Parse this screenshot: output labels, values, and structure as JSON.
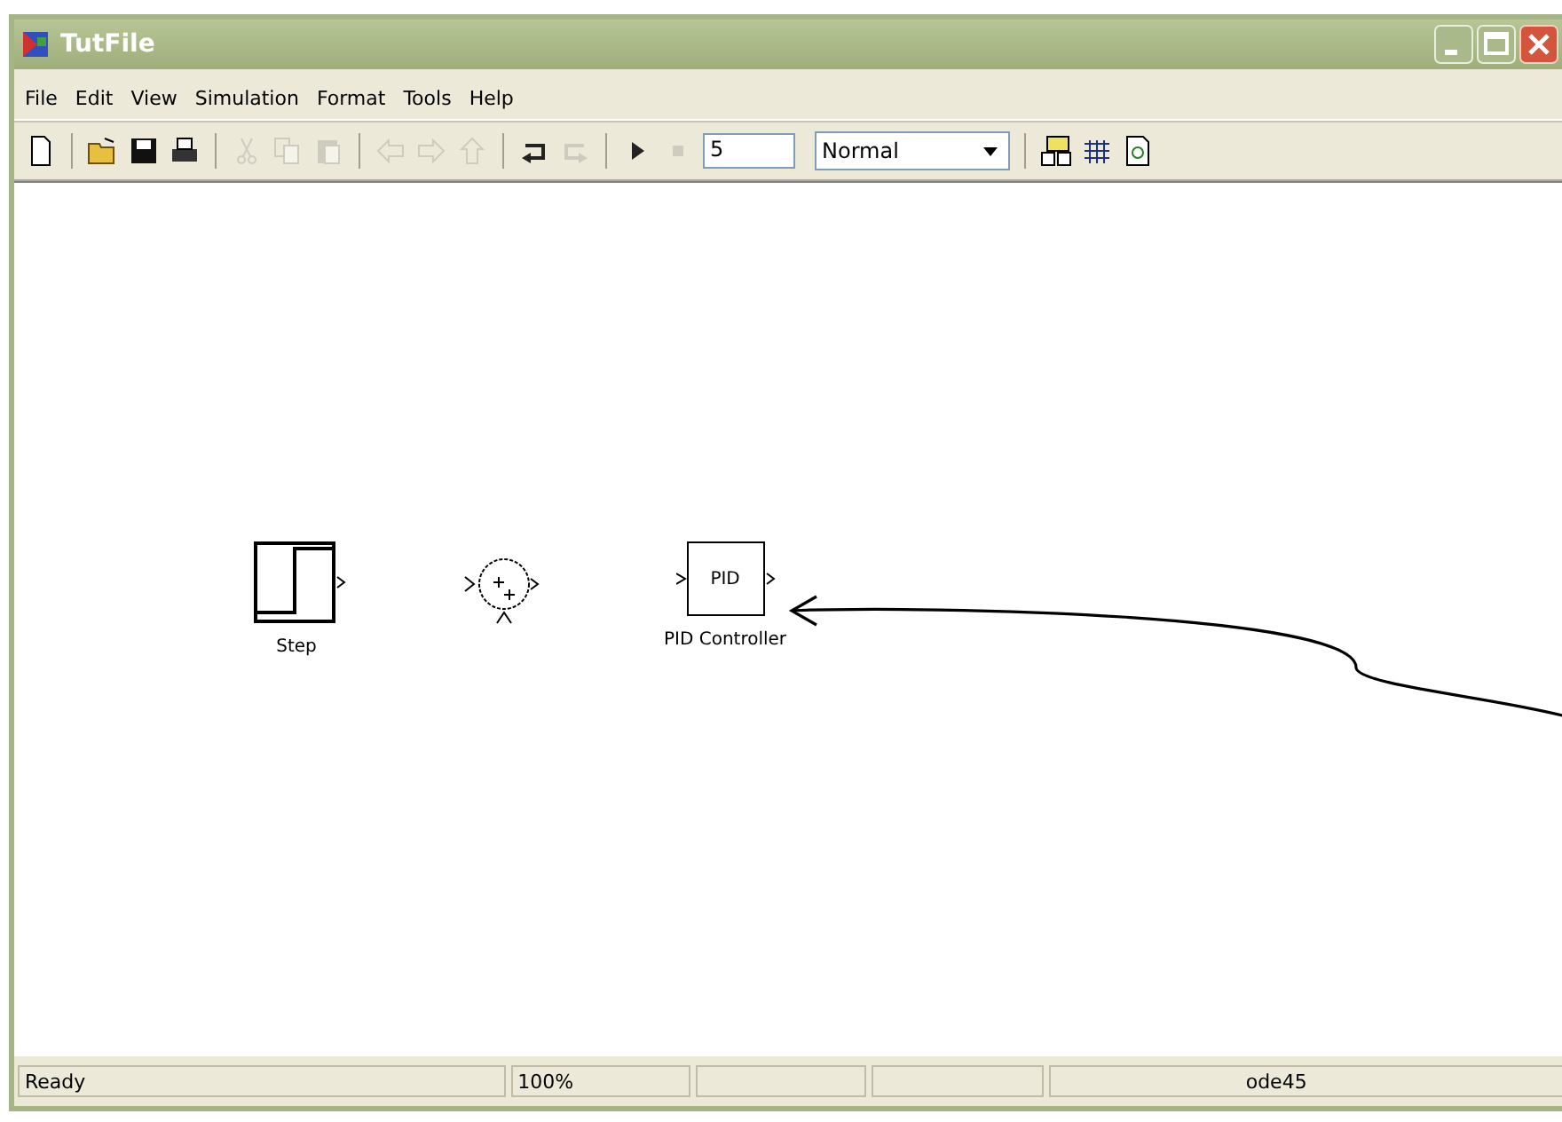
{
  "window": {
    "title": "TutFile"
  },
  "menu": [
    "File",
    "Edit",
    "View",
    "Simulation",
    "Format",
    "Tools",
    "Help"
  ],
  "toolbar": [
    {
      "kind": "new",
      "disabled": false
    },
    {
      "kind": "sep"
    },
    {
      "kind": "open",
      "disabled": false
    },
    {
      "kind": "save",
      "disabled": false
    },
    {
      "kind": "print",
      "disabled": false
    },
    {
      "kind": "sep"
    },
    {
      "kind": "cut",
      "disabled": true
    },
    {
      "kind": "copy",
      "disabled": true
    },
    {
      "kind": "paste",
      "disabled": true
    },
    {
      "kind": "sep"
    },
    {
      "kind": "back",
      "disabled": true
    },
    {
      "kind": "forward",
      "disabled": true
    },
    {
      "kind": "up",
      "disabled": true
    },
    {
      "kind": "sep"
    },
    {
      "kind": "undo",
      "disabled": false
    },
    {
      "kind": "redo",
      "disabled": true
    },
    {
      "kind": "sep"
    },
    {
      "kind": "play",
      "disabled": false
    },
    {
      "kind": "stop",
      "disabled": true
    }
  ],
  "stop_time": "5",
  "sim_mode": "Normal",
  "toolbar_right": [
    {
      "kind": "library"
    },
    {
      "kind": "explorer"
    },
    {
      "kind": "refresh"
    }
  ],
  "blocks": [
    {
      "kind": "step",
      "label": "Step"
    },
    {
      "kind": "sum"
    },
    {
      "kind": "pid",
      "text": "PID",
      "label": "PID Controller"
    }
  ],
  "status_bar": {
    "state": "Ready",
    "zoom": "100%",
    "solver": "ode45"
  }
}
